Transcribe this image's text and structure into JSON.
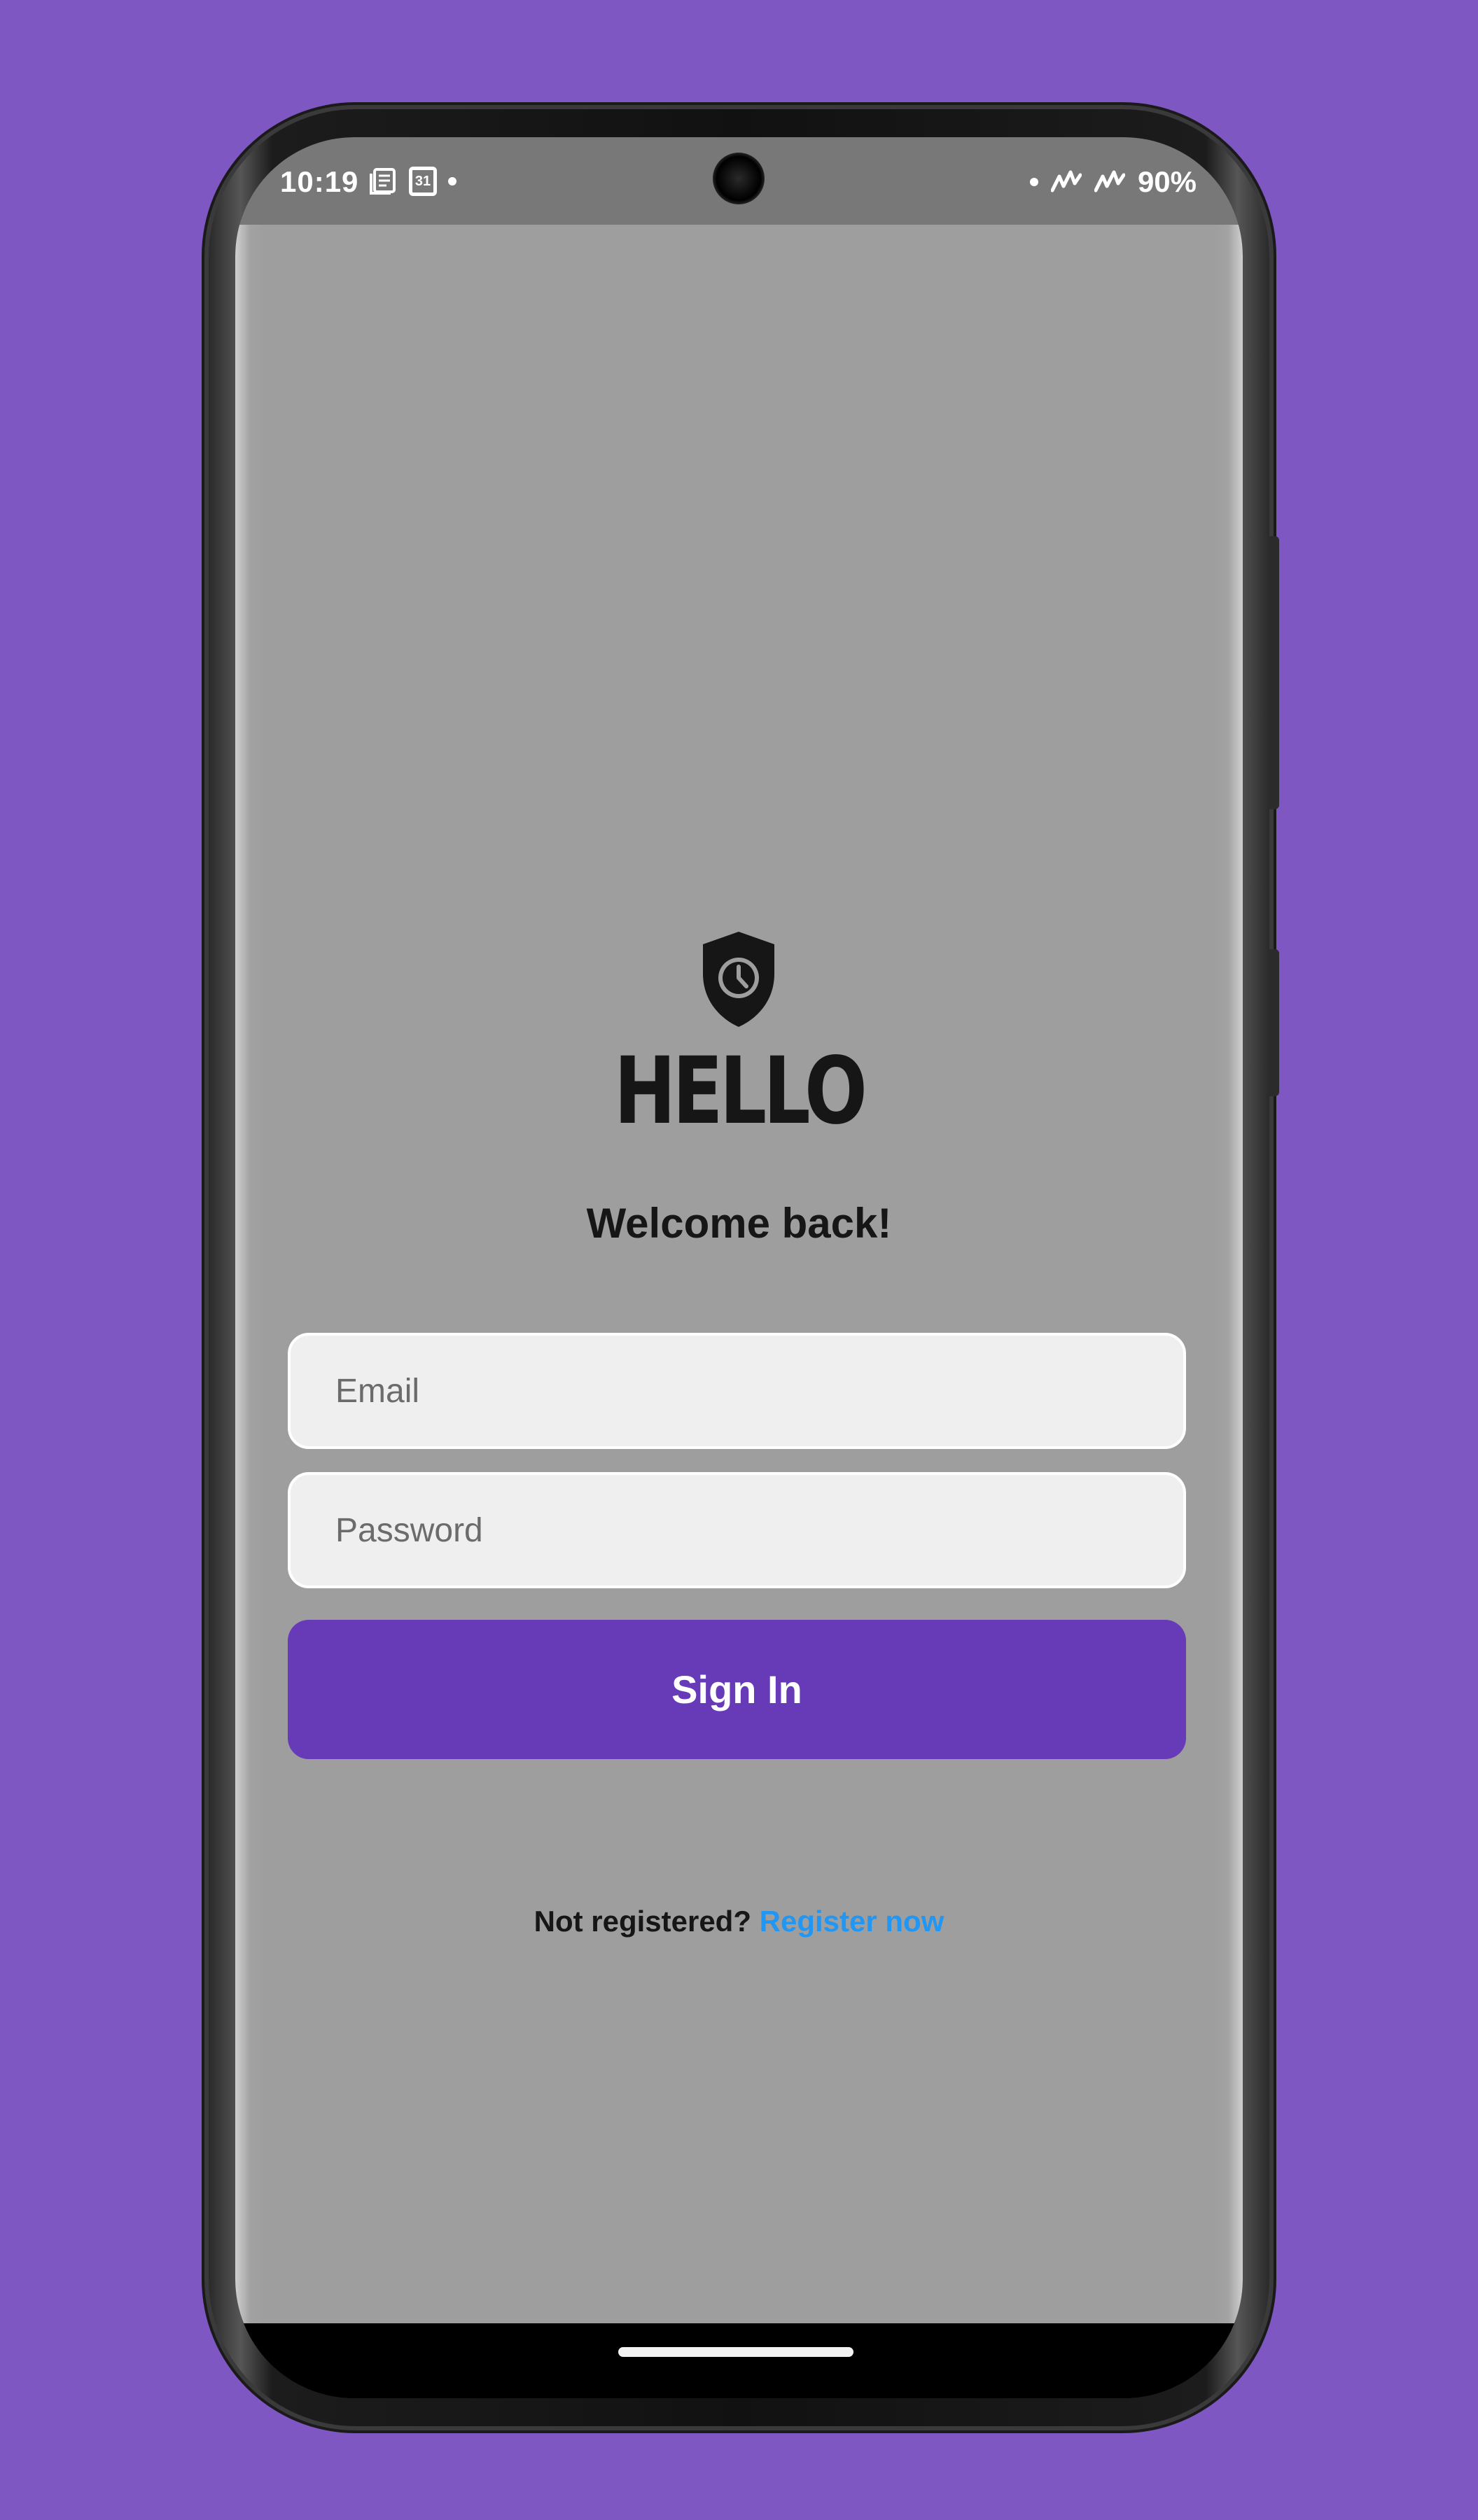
{
  "status_bar": {
    "time": "10:19",
    "calendar_day": "31",
    "battery": "90%"
  },
  "app": {
    "logo_text": "HELLO",
    "welcome_text": "Welcome back!",
    "email_placeholder": "Email",
    "password_placeholder": "Password",
    "signin_label": "Sign In",
    "not_registered_text": "Not registered?",
    "register_link_text": "Register now"
  },
  "colors": {
    "background": "#7e57c2",
    "app_background": "#9e9e9e",
    "primary_button": "#673ab7",
    "link": "#2196f3"
  }
}
